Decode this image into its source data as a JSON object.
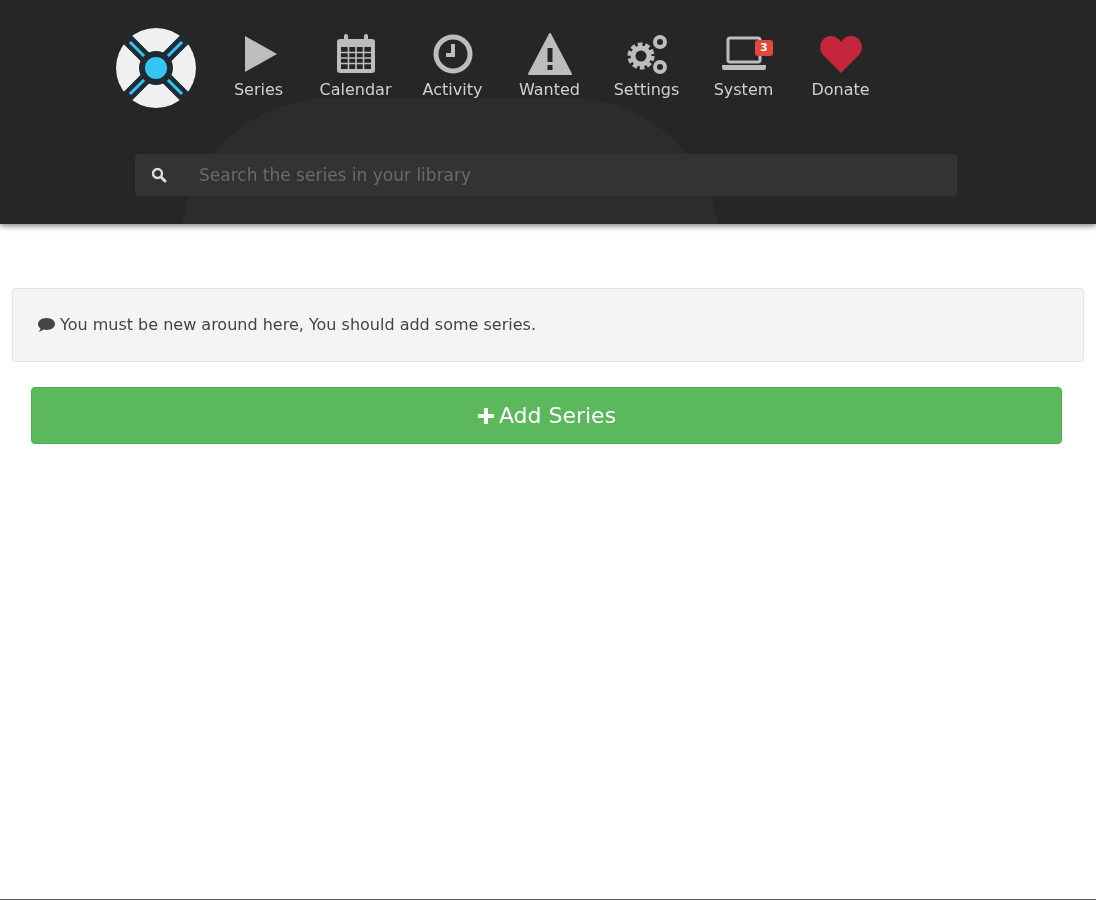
{
  "nav": [
    {
      "kind": "play",
      "label": "Series"
    },
    {
      "kind": "calendar",
      "label": "Calendar"
    },
    {
      "kind": "clock",
      "label": "Activity"
    },
    {
      "kind": "warning",
      "label": "Wanted"
    },
    {
      "kind": "gears",
      "label": "Settings"
    },
    {
      "kind": "laptop",
      "label": "System",
      "badge": "3"
    },
    {
      "kind": "heart",
      "label": "Donate"
    }
  ],
  "search": {
    "placeholder": "Search the series in your library"
  },
  "notice": {
    "text": "You must be new around here, You should add some series."
  },
  "add_button": {
    "label": "Add Series"
  }
}
